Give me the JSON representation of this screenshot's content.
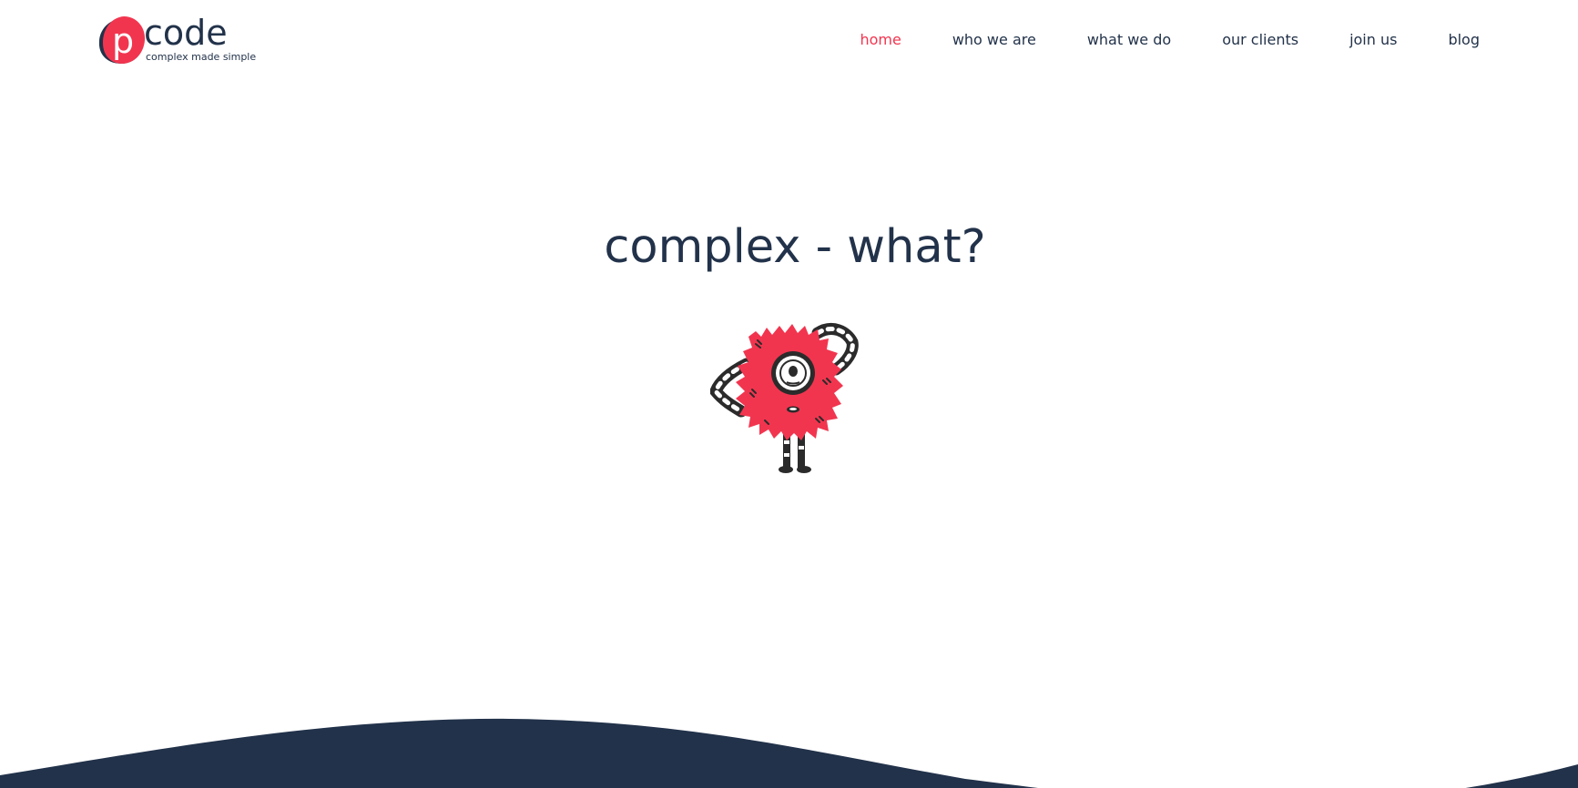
{
  "brand": {
    "logo_letter": "p",
    "name": "code",
    "tagline": "complex made simple"
  },
  "nav": {
    "items": [
      {
        "label": "home",
        "active": true
      },
      {
        "label": "who we are",
        "active": false
      },
      {
        "label": "what we do",
        "active": false
      },
      {
        "label": "our clients",
        "active": false
      },
      {
        "label": "join us",
        "active": false
      },
      {
        "label": "blog",
        "active": false
      }
    ]
  },
  "hero": {
    "title": "complex - what?",
    "illustration": "red-one-eyed-monster-icon"
  },
  "colors": {
    "accent": "#f2354f",
    "navy": "#22324a",
    "background": "#ffffff"
  }
}
